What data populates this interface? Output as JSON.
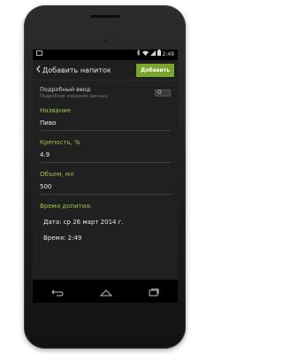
{
  "status": {
    "time": "2:49"
  },
  "actionbar": {
    "title": "Добавить напиток",
    "add_label": "Добавить"
  },
  "form": {
    "detailed": {
      "label": "Подробный ввод",
      "hint": "Подробное указание данных",
      "toggle_text": "O"
    },
    "name": {
      "label": "Название",
      "value": "Пиво"
    },
    "strength": {
      "label": "Крепость, %",
      "value": "4.9"
    },
    "volume": {
      "label": "Объем, мл",
      "value": "500"
    },
    "drink_time": {
      "label": "Время допития:",
      "date": "Дата: ср 26 март 2014 г.",
      "time": "Время:  2:49"
    }
  },
  "colors": {
    "accent": "#9bc642",
    "button": "#7aa52c",
    "background": "#202020"
  },
  "icons": {
    "status": [
      "image-icon",
      "bluetooth-icon",
      "wifi-icon",
      "signal-icon",
      "battery-icon"
    ],
    "nav": [
      "back-icon",
      "home-icon",
      "recents-icon"
    ]
  }
}
